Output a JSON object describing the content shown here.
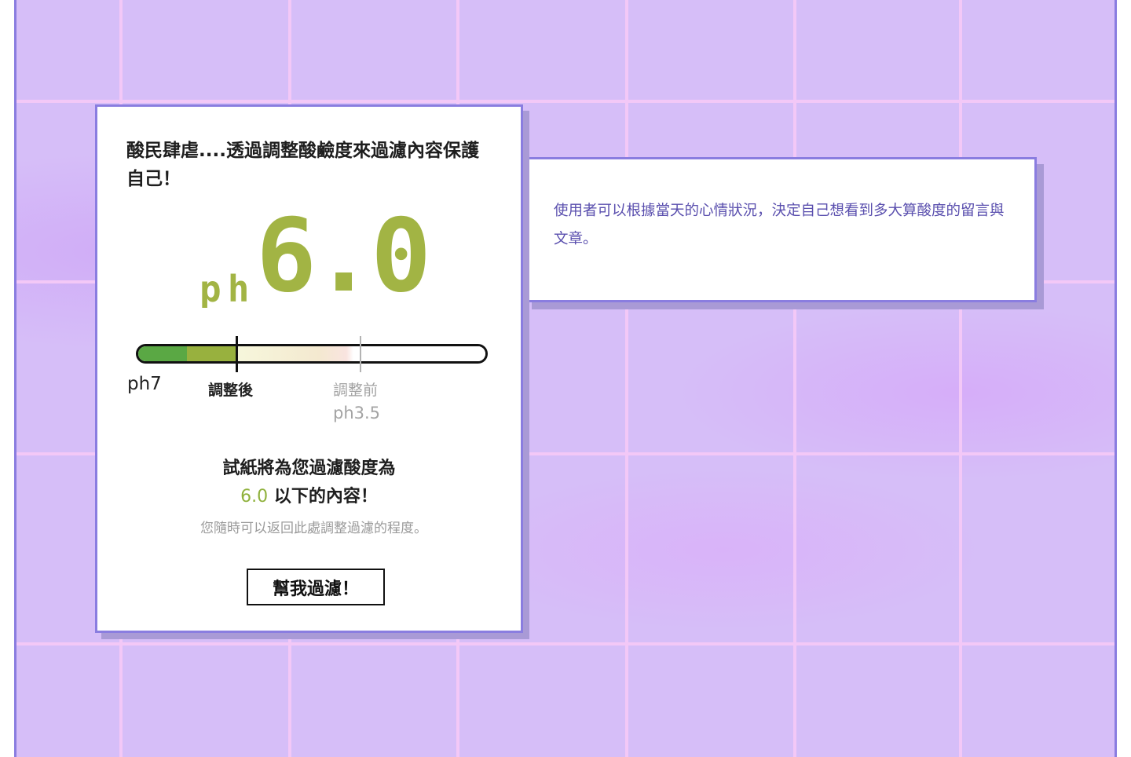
{
  "heading": "酸民肆虐....透過調整酸鹼度來過濾內容保護自己！",
  "ph_display": {
    "prefix": "ph",
    "value": "6.0",
    "color": "#a2b444"
  },
  "gauge": {
    "scale_label": "ph7",
    "after_label": "調整後",
    "before_label": "調整前",
    "before_value": "ph3.5",
    "colors": [
      "#5aa844",
      "#98b13e"
    ]
  },
  "result": {
    "line1": "試紙將為您過濾酸度為",
    "value": "6.0",
    "suffix": " 以下的內容！",
    "hint": "您隨時可以返回此處調整過濾的程度。"
  },
  "button_label": "幫我過濾！",
  "info": {
    "text": "使用者可以根據當天的心情狀況，決定自己想看到多大算酸度的留言與文章。"
  },
  "theme": {
    "accent": "#8a7de0",
    "background": "#d6bef8",
    "grid": "#f3c8f7",
    "info_text": "#5a4fae",
    "value_green": "#8fb13c"
  }
}
